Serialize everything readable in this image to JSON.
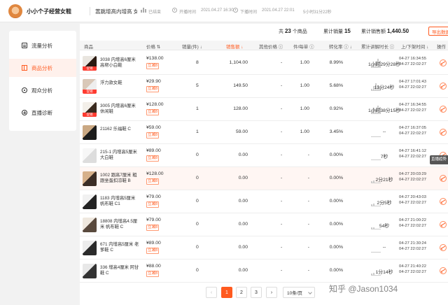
{
  "header": {
    "shop_name": "小小个子经营女鞋",
    "live_title": "蒿跳增高内增高 女…",
    "status": "已结束",
    "start_label": "开播时间",
    "start_time": "2021.04.27 16:30",
    "end_label": "下播时间",
    "end_time": "2021.04.27 22:01",
    "duration": "5小时31分22秒"
  },
  "sidebar": {
    "items": [
      {
        "label": "流量分析",
        "icon": "document-icon"
      },
      {
        "label": "商品分析",
        "icon": "grid-icon"
      },
      {
        "label": "观众分析",
        "icon": "eye-icon"
      },
      {
        "label": "直播诊断",
        "icon": "plus-circle-icon"
      }
    ]
  },
  "summary": {
    "total_prefix": "共",
    "total_count": "23",
    "total_suffix": "个商品",
    "sales_label": "累计销量",
    "sales_value": "15",
    "revenue_label": "累计销售额",
    "revenue_value": "1,440.50",
    "export_label": "导出数据"
  },
  "table": {
    "headers": [
      "商品",
      "价格 ⇅",
      "销量(件) ↓",
      "销售额 ↓",
      "其他价格 ⓘ",
      "件/每单 ⓘ",
      "转化率 ⓘ ↓",
      "累计讲解时长 ⓘ",
      "上/下架时间 ↓",
      "操作"
    ],
    "promo_label": "立减8",
    "rows": [
      {
        "name": [
          "3038 内增高6厘米",
          "高帮小白鞋"
        ],
        "price": "¥138.00",
        "sales": "8",
        "revenue": "1,104.00",
        "other": "-",
        "per_order": "1.00",
        "conv": "8.99%",
        "duration": "1小时29分28秒",
        "up": "04-27  16:34:55",
        "down": "04-27  22:02:27",
        "tag": "促销",
        "hl": false
      },
      {
        "name": [
          "浮力款女鞋"
        ],
        "price": "¥29.90",
        "sales": "5",
        "revenue": "149.50",
        "other": "-",
        "per_order": "1.00",
        "conv": "5.68%",
        "duration": "13分24秒",
        "up": "04-27  17:01:43",
        "down": "04-27  22:02:27",
        "tag": "促销",
        "hl": false
      },
      {
        "name": [
          "3005 内增高6厘米",
          "休闲鞋"
        ],
        "price": "¥128.00",
        "sales": "1",
        "revenue": "128.00",
        "other": "-",
        "per_order": "1.00",
        "conv": "0.92%",
        "duration": "1小时38分15秒",
        "up": "04-27  16:34:55",
        "down": "04-27  22:02:27",
        "tag": "促销",
        "hl": false
      },
      {
        "name": [
          "21162 乐福鞋 C"
        ],
        "price": "¥59.00",
        "sales": "1",
        "revenue": "59.00",
        "other": "-",
        "per_order": "1.00",
        "conv": "3.45%",
        "duration": "--",
        "up": "04-27  16:37:05",
        "down": "04-27  22:02:27",
        "tag": "",
        "hl": false
      },
      {
        "name": [
          "215-1 内增高5厘米",
          "大白鞋"
        ],
        "price": "¥89.00",
        "sales": "0",
        "revenue": "0.00",
        "other": "-",
        "per_order": "-",
        "conv": "0.00%",
        "duration": "7秒",
        "up": "04-27  16:41:12",
        "down": "04-27  22:02:27",
        "tag": "",
        "hl": false
      },
      {
        "name": [
          "1002 跟高7厘米 粗",
          "跟坐蛋扣凉鞋 B"
        ],
        "price": "¥128.00",
        "sales": "0",
        "revenue": "0.00",
        "other": "-",
        "per_order": "-",
        "conv": "0.00%",
        "duration": "2分21秒",
        "up": "04-27  20:03:29",
        "down": "04-27  22:02:27",
        "tag": "",
        "hl": true
      },
      {
        "name": [
          "1183 内增高5厘米",
          "帆布鞋 C1"
        ],
        "price": "¥79.00",
        "sales": "0",
        "revenue": "0.00",
        "other": "-",
        "per_order": "-",
        "conv": "0.00%",
        "duration": "2分5秒",
        "up": "04-27  20:43:03",
        "down": "04-27  22:02:27",
        "tag": "",
        "hl": false
      },
      {
        "name": [
          "18808 内增高4.5厘",
          "米 帆布鞋 C"
        ],
        "price": "¥79.00",
        "sales": "0",
        "revenue": "0.00",
        "other": "-",
        "per_order": "-",
        "conv": "0.00%",
        "duration": "54秒",
        "up": "04-27  21:00:22",
        "down": "04-27  22:02:27",
        "tag": "",
        "hl": false
      },
      {
        "name": [
          "671 内增高5厘米 老",
          "爹鞋 C"
        ],
        "price": "¥89.00",
        "sales": "0",
        "revenue": "0.00",
        "other": "-",
        "per_order": "-",
        "conv": "0.00%",
        "duration": "--",
        "up": "04-27  21:30:24",
        "down": "04-27  22:02:27",
        "tag": "",
        "hl": false
      },
      {
        "name": [
          "336 增高4厘米 阿甘",
          "鞋 C"
        ],
        "price": "¥88.00",
        "sales": "0",
        "revenue": "0.00",
        "other": "-",
        "per_order": "-",
        "conv": "0.00%",
        "duration": "1分14秒",
        "up": "04-27  21:40:22",
        "down": "04-27  22:02:27",
        "tag": "",
        "hl": false
      }
    ]
  },
  "tooltip": "直播趋势",
  "pagination": {
    "prev": "‹",
    "pages": [
      "1",
      "2",
      "3"
    ],
    "next": "›",
    "page_size": "10条/页"
  },
  "watermark": "知乎 @Jason1034",
  "colors": {
    "accent": "#ff5a1f",
    "tag": "#ff3b30"
  }
}
